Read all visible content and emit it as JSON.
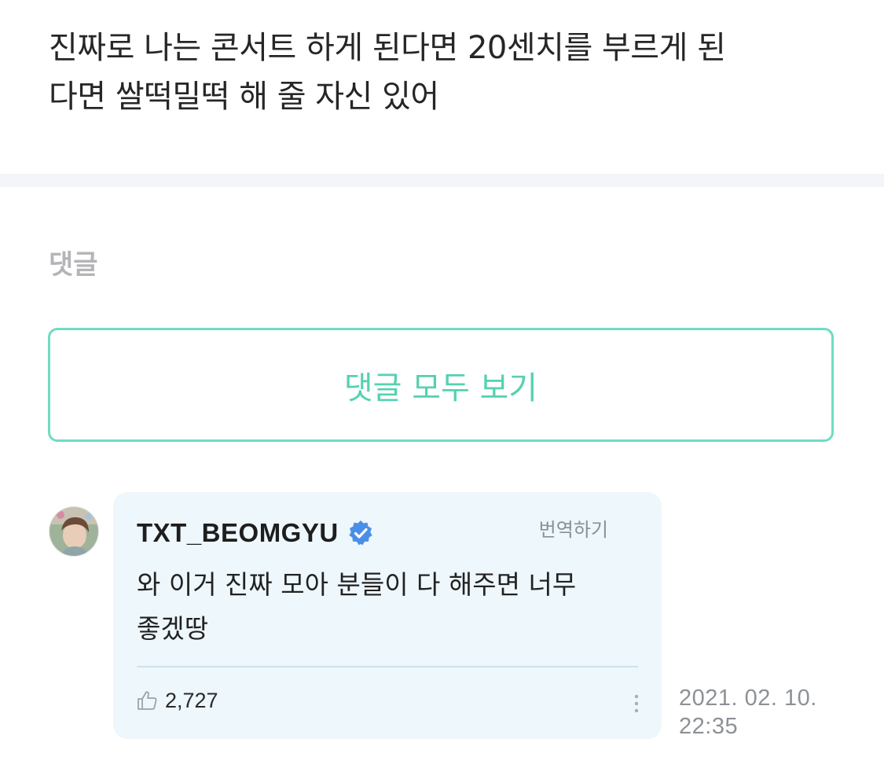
{
  "post": {
    "text_line1": "진짜로 나는 콘서트 하게 된다면 20센치를 부르게 된",
    "text_line2": "다면 쌀떡밀떡 해 줄 자신 있어"
  },
  "comments_section": {
    "heading": "댓글",
    "view_all_label": "댓글 모두 보기",
    "accent_color": "#55d1b1"
  },
  "comment": {
    "author": "TXT_BEOMGYU",
    "verified": true,
    "translate_label": "번역하기",
    "text_line1": "와 이거 진짜 모아 분들이 다 해주면 너무",
    "text_line2": "좋겠땅",
    "like_count": "2,727",
    "date": "2021. 02. 10.",
    "time": "22:35",
    "icons": {
      "verified": "verified-badge-icon",
      "like": "thumbs-up-icon",
      "more": "more-vertical-icon"
    },
    "badge_color": "#4a8fe7",
    "bubble_color": "#eef7fc"
  }
}
